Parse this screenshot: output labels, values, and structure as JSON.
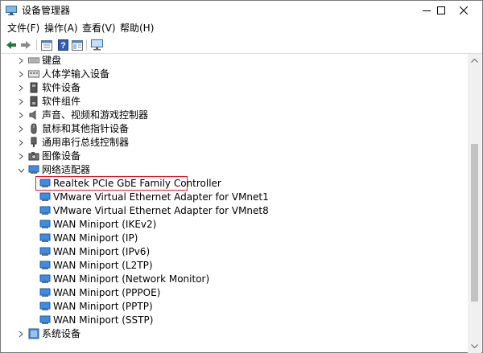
{
  "window": {
    "title": "设备管理器",
    "controls": {
      "minimize": "minimize",
      "maximize": "maximize",
      "close": "close"
    }
  },
  "menu": [
    {
      "label": "文件(F)"
    },
    {
      "label": "操作(A)"
    },
    {
      "label": "查看(V)"
    },
    {
      "label": "帮助(H)"
    }
  ],
  "toolbar": {
    "buttons": [
      "back-icon",
      "forward-icon",
      "properties-icon",
      "help-icon",
      "properties-pane-icon",
      "monitor-icon"
    ]
  },
  "tree": {
    "categories": [
      {
        "label": "键盘",
        "icon": "keyboard-icon",
        "expanded": false
      },
      {
        "label": "人体学输入设备",
        "icon": "hid-icon",
        "expanded": false
      },
      {
        "label": "软件设备",
        "icon": "software-device-icon",
        "expanded": false
      },
      {
        "label": "软件组件",
        "icon": "software-component-icon",
        "expanded": false
      },
      {
        "label": "声音、视频和游戏控制器",
        "icon": "speaker-icon",
        "expanded": false
      },
      {
        "label": "鼠标和其他指针设备",
        "icon": "mouse-icon",
        "expanded": false
      },
      {
        "label": "通用串行总线控制器",
        "icon": "usb-icon",
        "expanded": false
      },
      {
        "label": "图像设备",
        "icon": "camera-icon",
        "expanded": false
      },
      {
        "label": "网络适配器",
        "icon": "network-adapter-icon",
        "expanded": true
      }
    ],
    "network_adapters": [
      {
        "label": "Realtek PCIe GbE Family Controller",
        "highlighted": true
      },
      {
        "label": "VMware Virtual Ethernet Adapter for VMnet1"
      },
      {
        "label": "VMware Virtual Ethernet Adapter for VMnet8"
      },
      {
        "label": "WAN Miniport (IKEv2)"
      },
      {
        "label": "WAN Miniport (IP)"
      },
      {
        "label": "WAN Miniport (IPv6)"
      },
      {
        "label": "WAN Miniport (L2TP)"
      },
      {
        "label": "WAN Miniport (Network Monitor)"
      },
      {
        "label": "WAN Miniport (PPPOE)"
      },
      {
        "label": "WAN Miniport (PPTP)"
      },
      {
        "label": "WAN Miniport (SSTP)"
      }
    ],
    "after": [
      {
        "label": "系统设备",
        "icon": "system-device-icon",
        "expanded": false
      }
    ]
  },
  "colors": {
    "highlight_border": "#e0192b",
    "adapter_icon": "#2b7bd6"
  }
}
